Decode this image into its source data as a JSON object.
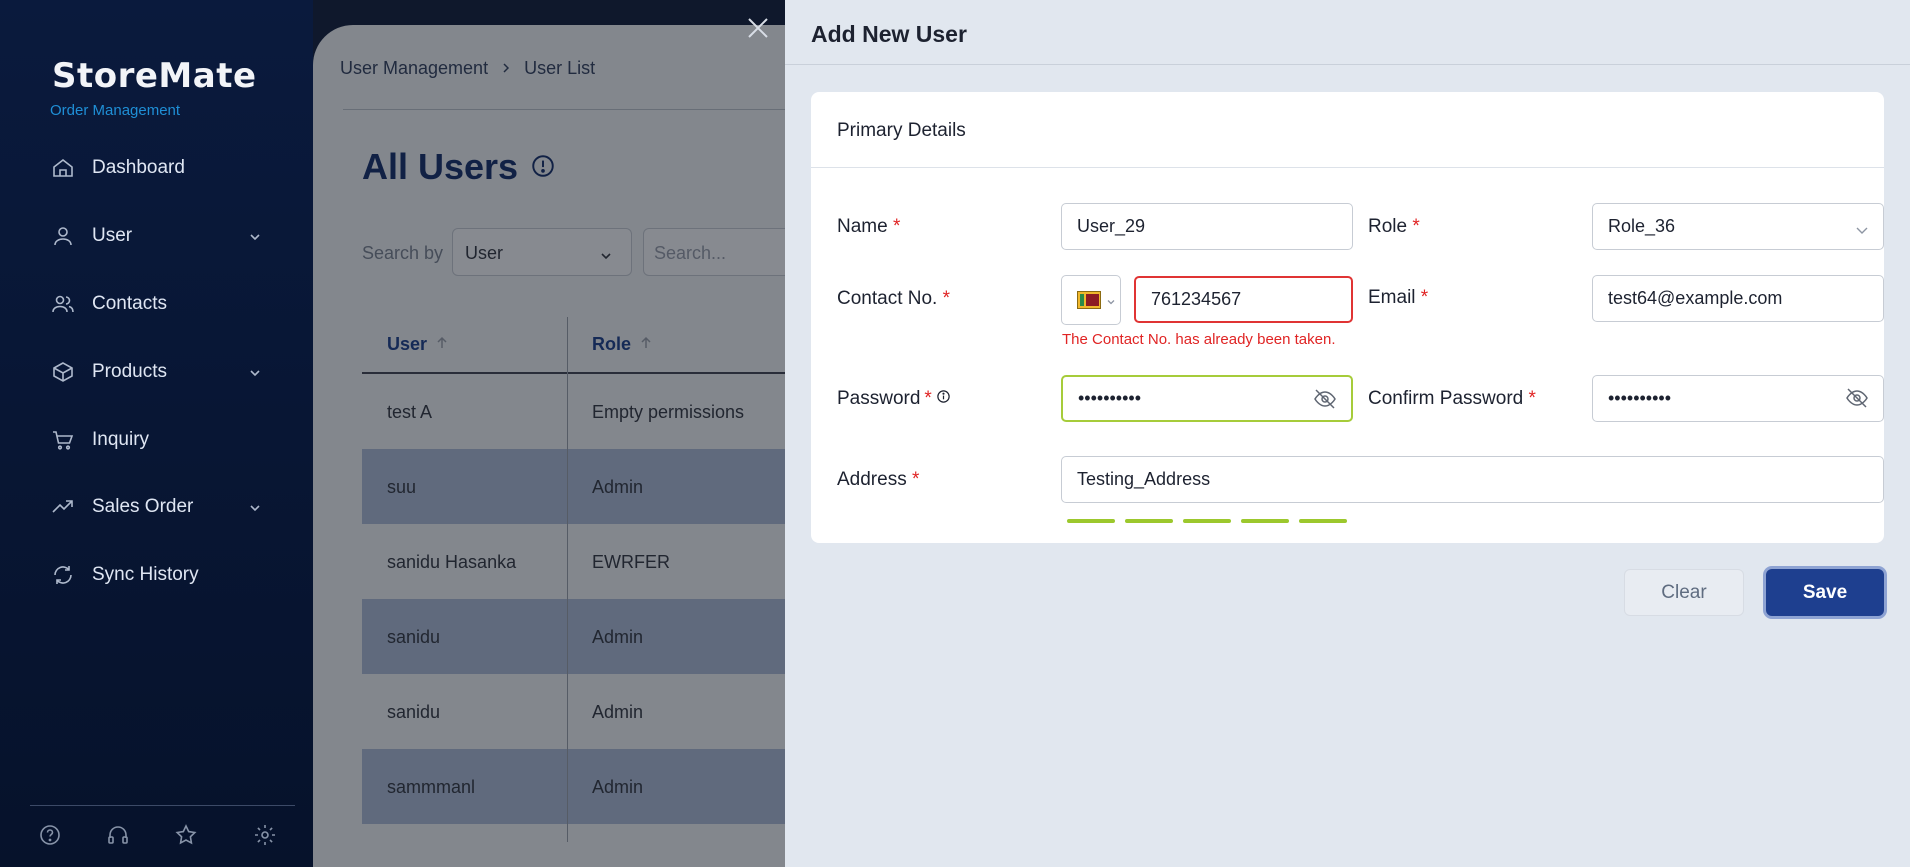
{
  "sidebar": {
    "logo": "StoreMate",
    "subtitle": "Order Management",
    "items": [
      {
        "label": "Dashboard"
      },
      {
        "label": "User"
      },
      {
        "label": "Contacts"
      },
      {
        "label": "Products"
      },
      {
        "label": "Inquiry"
      },
      {
        "label": "Sales Order"
      },
      {
        "label": "Sync History"
      }
    ]
  },
  "main": {
    "breadcrumb": [
      "User Management",
      "User List"
    ],
    "title": "All Users",
    "search_by_label": "Search by",
    "search_select_value": "User",
    "search_placeholder": "Search...",
    "columns": [
      "User",
      "Role"
    ],
    "rows": [
      {
        "user": "test A",
        "role": "Empty permissions"
      },
      {
        "user": "suu",
        "role": "Admin"
      },
      {
        "user": "sanidu Hasanka",
        "role": "EWRFER"
      },
      {
        "user": "sanidu",
        "role": "Admin"
      },
      {
        "user": "sanidu",
        "role": "Admin"
      },
      {
        "user": "sammmanl",
        "role": "Admin"
      }
    ]
  },
  "drawer": {
    "title": "Add New User",
    "section_title": "Primary Details",
    "name_label": "Name",
    "name_value": "User_29",
    "role_label": "Role",
    "role_value": "Role_36",
    "contact_label": "Contact No.",
    "contact_value": "761234567",
    "contact_error": "The Contact No. has already been taken.",
    "email_label": "Email",
    "email_value": "test64@example.com",
    "password_label": "Password",
    "password_value": "••••••••••",
    "confirm_label": "Confirm Password",
    "confirm_value": "••••••••••",
    "address_label": "Address",
    "address_value": "Testing_Address",
    "required_mark": "*",
    "clear_label": "Clear",
    "save_label": "Save"
  },
  "colors": {
    "sidebar_bg": "#0a1a3d",
    "accent": "#1e3f8f",
    "error": "#e02424",
    "strength": "#9cc82d"
  }
}
